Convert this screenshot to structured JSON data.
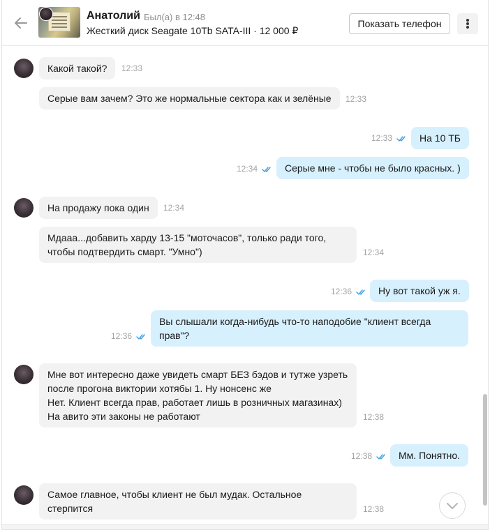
{
  "header": {
    "back_icon": "arrow-left-icon",
    "contact_name": "Анатолий",
    "status": "Был(а) в 12:48",
    "item_title": "Жесткий диск Seagate 10Tb SATA-III · 12 000 ₽",
    "show_phone_label": "Показать телефон",
    "more_icon": "more-vertical-icon"
  },
  "messages": [
    {
      "dir": "in",
      "text": "Какой такой?",
      "time": "12:33"
    },
    {
      "dir": "in",
      "text": "Серые вам зачем? Это же нормальные сектора как и зелёные",
      "time": "12:33"
    },
    {
      "dir": "out",
      "text": "На 10 ТБ",
      "time": "12:33"
    },
    {
      "dir": "out",
      "text": "Серые мне - чтобы не было красных. )",
      "time": "12:34"
    },
    {
      "dir": "in",
      "text": "На продажу пока один",
      "time": "12:34"
    },
    {
      "dir": "in",
      "line1": "Мдааа...добавить харду 13-15 \"моточасов\", только ради того,",
      "line2": "чтобы подтвердить смарт. \"Умно\")",
      "time": "12:34"
    },
    {
      "dir": "out",
      "text": "Ну вот такой уж я.",
      "time": "12:36"
    },
    {
      "dir": "out",
      "line1": "Вы слышали когда-нибудь что-то наподобие \"клиент всегда",
      "line2": "прав\"?",
      "time": "12:36"
    },
    {
      "dir": "in",
      "line1": "Мне вот интересно даже увидеть смарт БЕЗ бэдов и тутже узреть",
      "line2": "после прогона виктории хотябы 1. Ну нонсенс же",
      "line3": "Нет. Клиент всегда прав, работает лишь в розничных магазинах)",
      "line4": "На авито эти законы не работают",
      "time": "12:38"
    },
    {
      "dir": "out",
      "text": "Мм. Понятно.",
      "time": "12:38"
    },
    {
      "dir": "in",
      "line1": "Самое главное, чтобы клиент не был мудак. Остальное",
      "line2": "стерпится",
      "time": "12:38"
    }
  ],
  "colors": {
    "incoming_bubble": "#f2f2f2",
    "outgoing_bubble": "#d7f0fd",
    "read_tick": "#3b9fe0"
  },
  "scroll_down_icon": "chevron-down-icon"
}
